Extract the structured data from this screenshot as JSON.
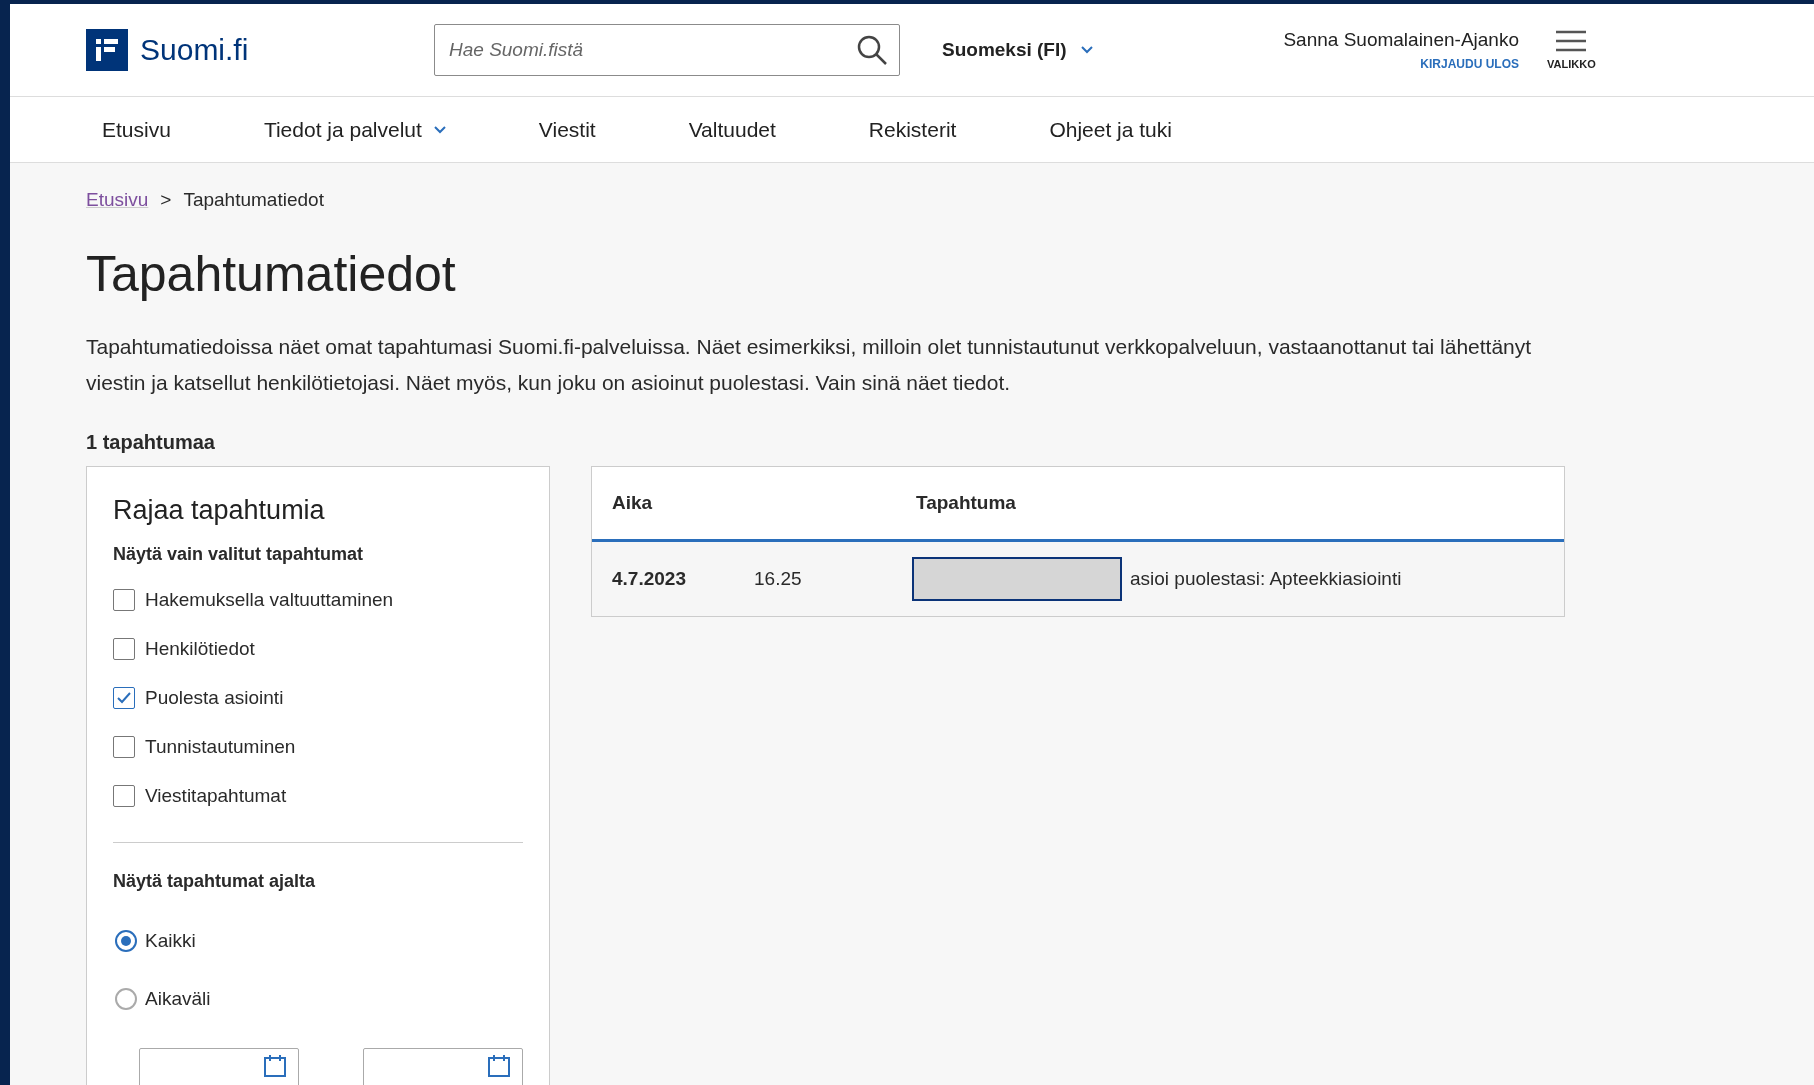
{
  "header": {
    "logo": "Suomi.fi",
    "search": {
      "placeholder": "Hae Suomi.fistä"
    },
    "language": "Suomeksi (FI)",
    "user": "Sanna Suomalainen-Ajanko",
    "logout": "KIRJAUDU ULOS",
    "menu": "VALIKKO"
  },
  "nav": [
    {
      "label": "Etusivu",
      "dropdown": false
    },
    {
      "label": "Tiedot ja palvelut",
      "dropdown": true
    },
    {
      "label": "Viestit",
      "dropdown": false
    },
    {
      "label": "Valtuudet",
      "dropdown": false
    },
    {
      "label": "Rekisterit",
      "dropdown": false
    },
    {
      "label": "Ohjeet ja tuki",
      "dropdown": false
    }
  ],
  "breadcrumb": [
    "Etusivu",
    "Tapahtumatiedot"
  ],
  "breadcrumb_separator": ">",
  "title": "Tapahtumatiedot",
  "intro": "Tapahtumatiedoissa näet omat tapahtumasi Suomi.fi-palveluissa. Näet esimerkiksi, milloin olet tunnistautunut verkkopalveluun, vastaanottanut tai lähettänyt viestin ja katsellut henkilötietojasi. Näet myös, kun joku on asioinut puolestasi. Vain sinä näet tiedot.",
  "count": "1 tapahtumaa",
  "filter": {
    "title": "Rajaa tapahtumia",
    "types_label": "Näytä vain valitut tapahtumat",
    "types": [
      {
        "label": "Hakemuksella valtuuttaminen",
        "checked": false
      },
      {
        "label": "Henkilötiedot",
        "checked": false
      },
      {
        "label": "Puolesta asiointi",
        "checked": true
      },
      {
        "label": "Tunnistautuminen",
        "checked": false
      },
      {
        "label": "Viestitapahtumat",
        "checked": false
      }
    ],
    "period_label": "Näytä tapahtumat ajalta",
    "periods": [
      {
        "label": "Kaikki",
        "selected": true
      },
      {
        "label": "Aikaväli",
        "selected": false
      }
    ]
  },
  "table": {
    "columns": [
      "Aika",
      "Tapahtuma"
    ],
    "rows": [
      {
        "date": "4.7.2023",
        "time": "16.25",
        "event": "asioi puolestasi: Apteekkiasiointi",
        "redacted": true
      }
    ]
  }
}
